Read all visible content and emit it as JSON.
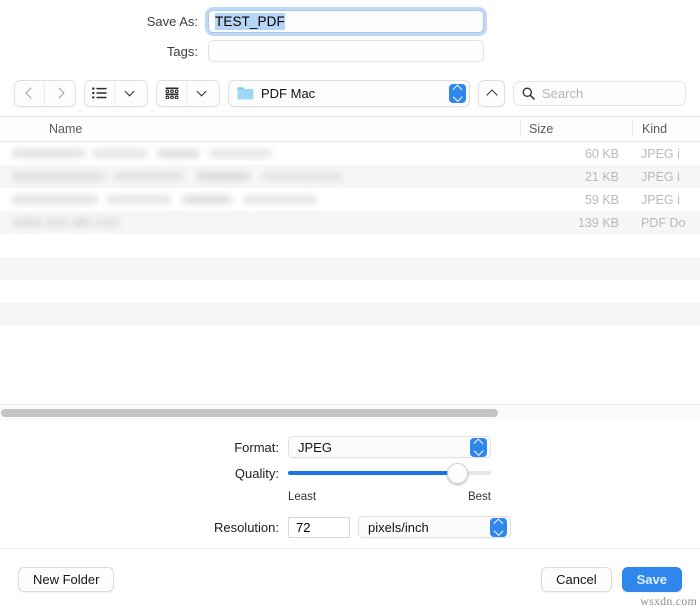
{
  "save_panel": {
    "save_as": {
      "label": "Save As:",
      "value": "TEST_PDF"
    },
    "tags": {
      "label": "Tags:",
      "value": "",
      "placeholder": ""
    }
  },
  "toolbar": {
    "back_icon": "chevron-left-icon",
    "forward_icon": "chevron-right-icon",
    "list_view_icon": "list-view-icon",
    "icon_view_icon": "icon-view-icon",
    "path_popup": {
      "folder_name": "PDF Mac",
      "folder_icon": "folder-icon"
    },
    "disclosure_icon": "chevron-up-icon",
    "search": {
      "placeholder": "Search",
      "value": "",
      "icon": "search-icon"
    }
  },
  "file_list": {
    "columns": [
      "Name",
      "Size",
      "Kind"
    ],
    "rows": [
      {
        "name": "",
        "size": "60 KB",
        "kind": "JPEG i"
      },
      {
        "name": "",
        "size": "21 KB",
        "kind": "JPEG i"
      },
      {
        "name": "",
        "size": "59 KB",
        "kind": "JPEG i"
      },
      {
        "name": "",
        "size": "139 KB",
        "kind": "PDF Do"
      }
    ],
    "scrollbar": {
      "orientation": "horizontal",
      "thumb_fraction": 0.71
    }
  },
  "accessory": {
    "format": {
      "label": "Format:",
      "value": "JPEG"
    },
    "quality": {
      "label": "Quality:",
      "min_label": "Least",
      "max_label": "Best",
      "value_percent": 83
    },
    "resolution": {
      "label": "Resolution:",
      "value": "72",
      "unit": "pixels/inch"
    }
  },
  "buttons": {
    "new_folder": "New Folder",
    "cancel": "Cancel",
    "save": "Save"
  },
  "watermark": "wsxdn.com",
  "colors": {
    "accent": "#2f86ec",
    "slider_fill": "#1a73e8",
    "selection": "#b6d4f4",
    "focus_ring": "#78aaeb"
  }
}
